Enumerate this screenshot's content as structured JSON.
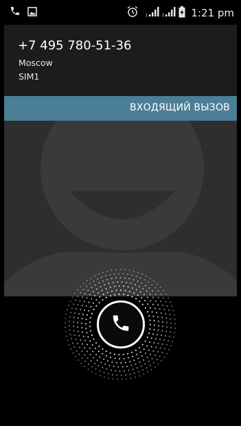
{
  "status_bar": {
    "time": "1:21 pm",
    "left_icons": [
      "phone-icon",
      "picture-icon"
    ],
    "right_icons": [
      "alarm-icon",
      "signal-sim1-icon",
      "signal-sim2-icon",
      "battery-charging-icon"
    ]
  },
  "caller": {
    "number": "+7 495 780-51-36",
    "location": "Moscow",
    "sim": "SIM1"
  },
  "call_state": "ВХОДЯЩИЙ ВЫЗОВ",
  "colors": {
    "banner": "#4a7f95",
    "caller_bg": "#1c1c1c",
    "photo_bg": "#2e2e2e"
  },
  "answer_control": {
    "icon": "phone-handset-icon"
  }
}
